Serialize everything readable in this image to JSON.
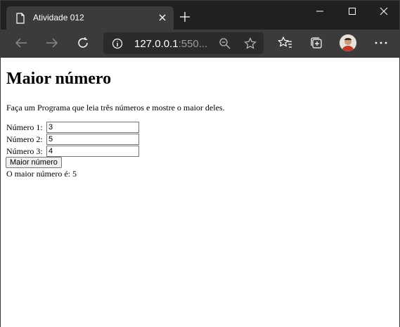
{
  "browser": {
    "tab_title": "Atividade 012",
    "address_host": "127.0.0.1",
    "address_rest": ":550..."
  },
  "page": {
    "heading": "Maior número",
    "description": "Faça um Programa que leia três números e mostre o maior deles.",
    "fields": [
      {
        "label": "Número 1:",
        "value": "3"
      },
      {
        "label": "Número 2:",
        "value": "5"
      },
      {
        "label": "Número 3:",
        "value": "4"
      }
    ],
    "button_label": "Maior número",
    "result_text": "O maior número é: 5"
  }
}
